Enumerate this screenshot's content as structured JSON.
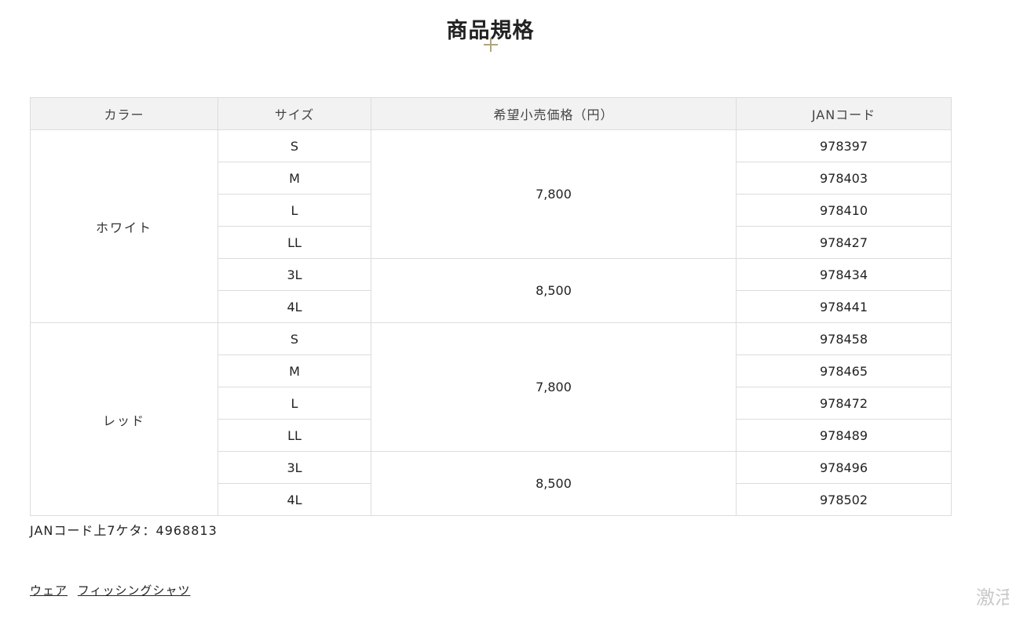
{
  "section": {
    "title": "商品規格"
  },
  "icons": {
    "plus": "plus-icon",
    "accent_color": "#b1a57f"
  },
  "table": {
    "headers": [
      "カラー",
      "サイズ",
      "希望小売価格（円）",
      "JANコード"
    ],
    "groups": [
      {
        "color": "ホワイト",
        "rows": [
          {
            "size": "S",
            "jan": "978397"
          },
          {
            "size": "M",
            "jan": "978403"
          },
          {
            "size": "L",
            "jan": "978410"
          },
          {
            "size": "LL",
            "jan": "978427"
          },
          {
            "size": "3L",
            "jan": "978434"
          },
          {
            "size": "4L",
            "jan": "978441"
          }
        ],
        "prices": [
          "7,800",
          "8,500"
        ]
      },
      {
        "color": "レッド",
        "rows": [
          {
            "size": "S",
            "jan": "978458"
          },
          {
            "size": "M",
            "jan": "978465"
          },
          {
            "size": "L",
            "jan": "978472"
          },
          {
            "size": "LL",
            "jan": "978489"
          },
          {
            "size": "3L",
            "jan": "978496"
          },
          {
            "size": "4L",
            "jan": "978502"
          }
        ],
        "prices": [
          "7,800",
          "8,500"
        ]
      }
    ]
  },
  "note": {
    "jan_prefix": "JANコード上7ケタ：4968813"
  },
  "tags": [
    {
      "label": "ウェア"
    },
    {
      "label": "フィッシングシャツ"
    }
  ],
  "watermark": {
    "text": "激活"
  }
}
